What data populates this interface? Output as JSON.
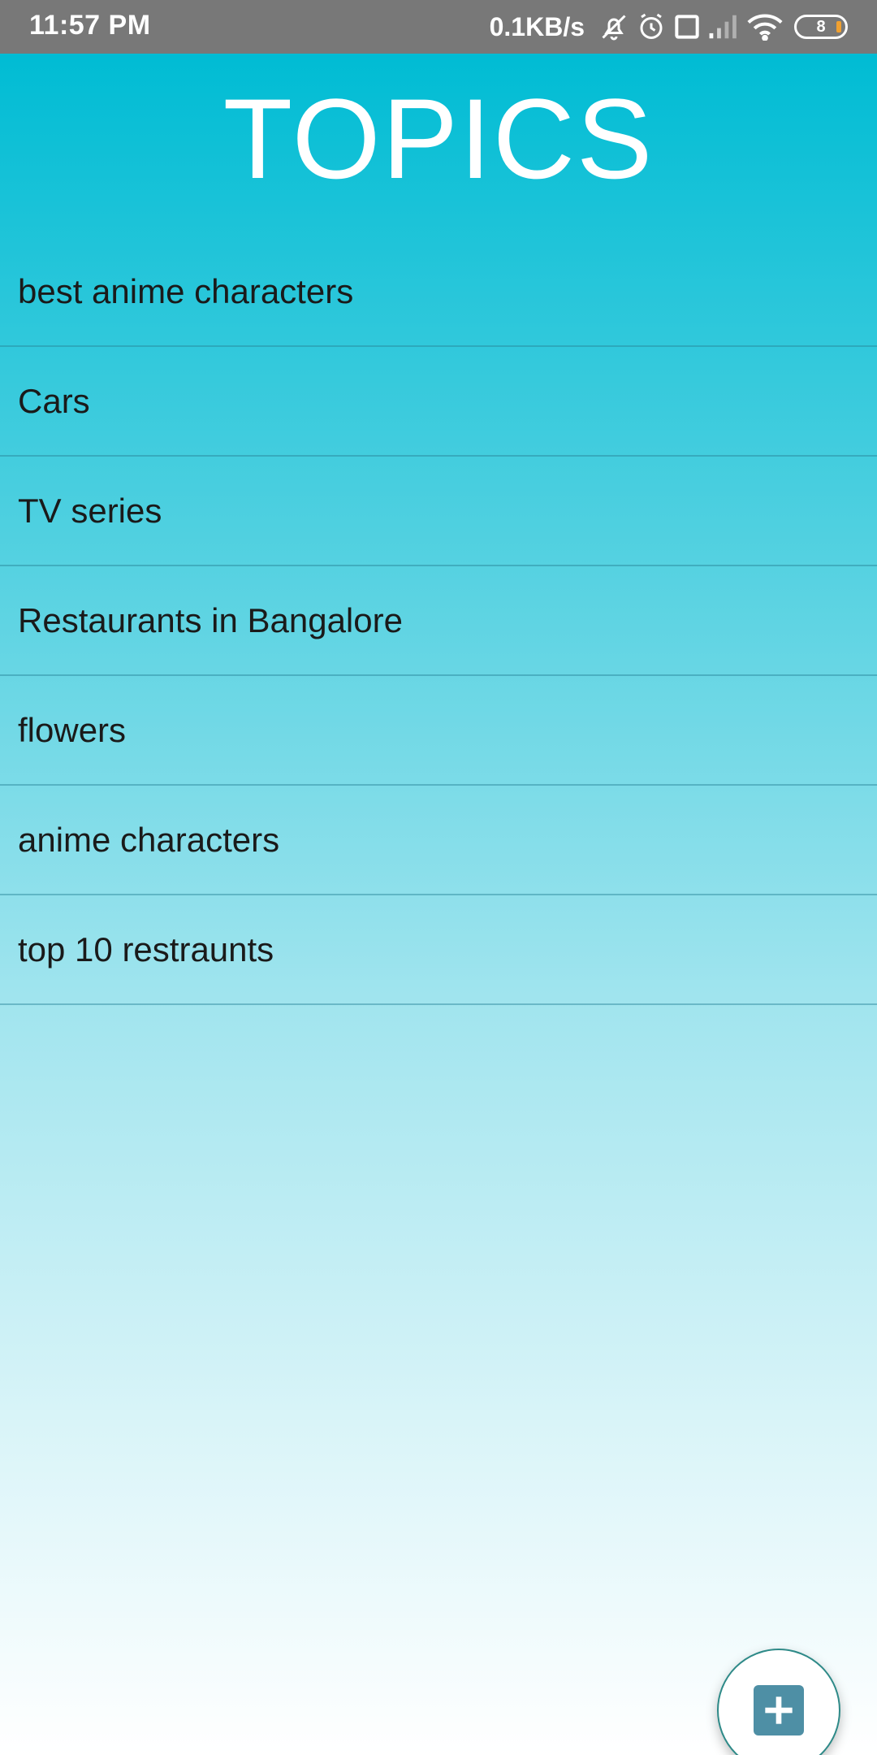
{
  "status_bar": {
    "time": "11:57 PM",
    "net_speed": "0.1KB/s",
    "battery_level": "8",
    "icons": [
      "bell-off-icon",
      "alarm-icon",
      "volte-icon",
      "signal-icon",
      "wifi-icon",
      "battery-icon"
    ]
  },
  "header": {
    "title": "TOPICS"
  },
  "topics": [
    {
      "label": "best anime characters"
    },
    {
      "label": "Cars"
    },
    {
      "label": "TV series"
    },
    {
      "label": "Restaurants in Bangalore"
    },
    {
      "label": "flowers"
    },
    {
      "label": "anime characters"
    },
    {
      "label": "top 10 restraunts"
    }
  ],
  "fab": {
    "icon": "plus-icon"
  },
  "colors": {
    "status_bar": "#787878",
    "gradient_top": "#00bcd4",
    "gradient_bottom": "#ffffff",
    "fab_accent": "#4e8fa5",
    "divider": "#2882967f"
  }
}
